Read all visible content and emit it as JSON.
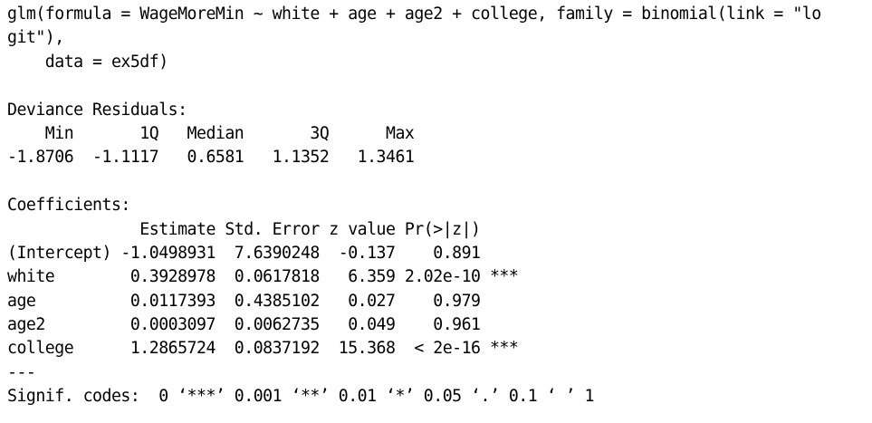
{
  "console": {
    "call_lines": [
      "glm(formula = WageMoreMin ~ white + age + age2 + college, family = binomial(link = \"lo",
      "git\"),",
      "    data = ex5df)"
    ],
    "deviance_residuals": {
      "heading": "Deviance Residuals:",
      "header_line": "    Min       1Q   Median       3Q      Max  ",
      "values_line": "-1.8706  -1.1117   0.6581   1.1352   1.3461  "
    },
    "coefficients": {
      "heading": "Coefficients:",
      "header_line": "              Estimate Std. Error z value Pr(>|z|)    ",
      "rows": [
        "(Intercept) -1.0498931  7.6390248  -0.137    0.891    ",
        "white        0.3928978  0.0617818   6.359 2.02e-10 ***",
        "age          0.0117393  0.4385102   0.027    0.979    ",
        "age2         0.0003097  0.0062735   0.049    0.961    ",
        "college      1.2865724  0.0837192  15.368  < 2e-16 ***"
      ],
      "separator": "---",
      "signif_codes": "Signif. codes:  0 ‘***’ 0.001 ‘**’ 0.01 ‘*’ 0.05 ‘.’ 0.1 ‘ ’ 1"
    }
  }
}
